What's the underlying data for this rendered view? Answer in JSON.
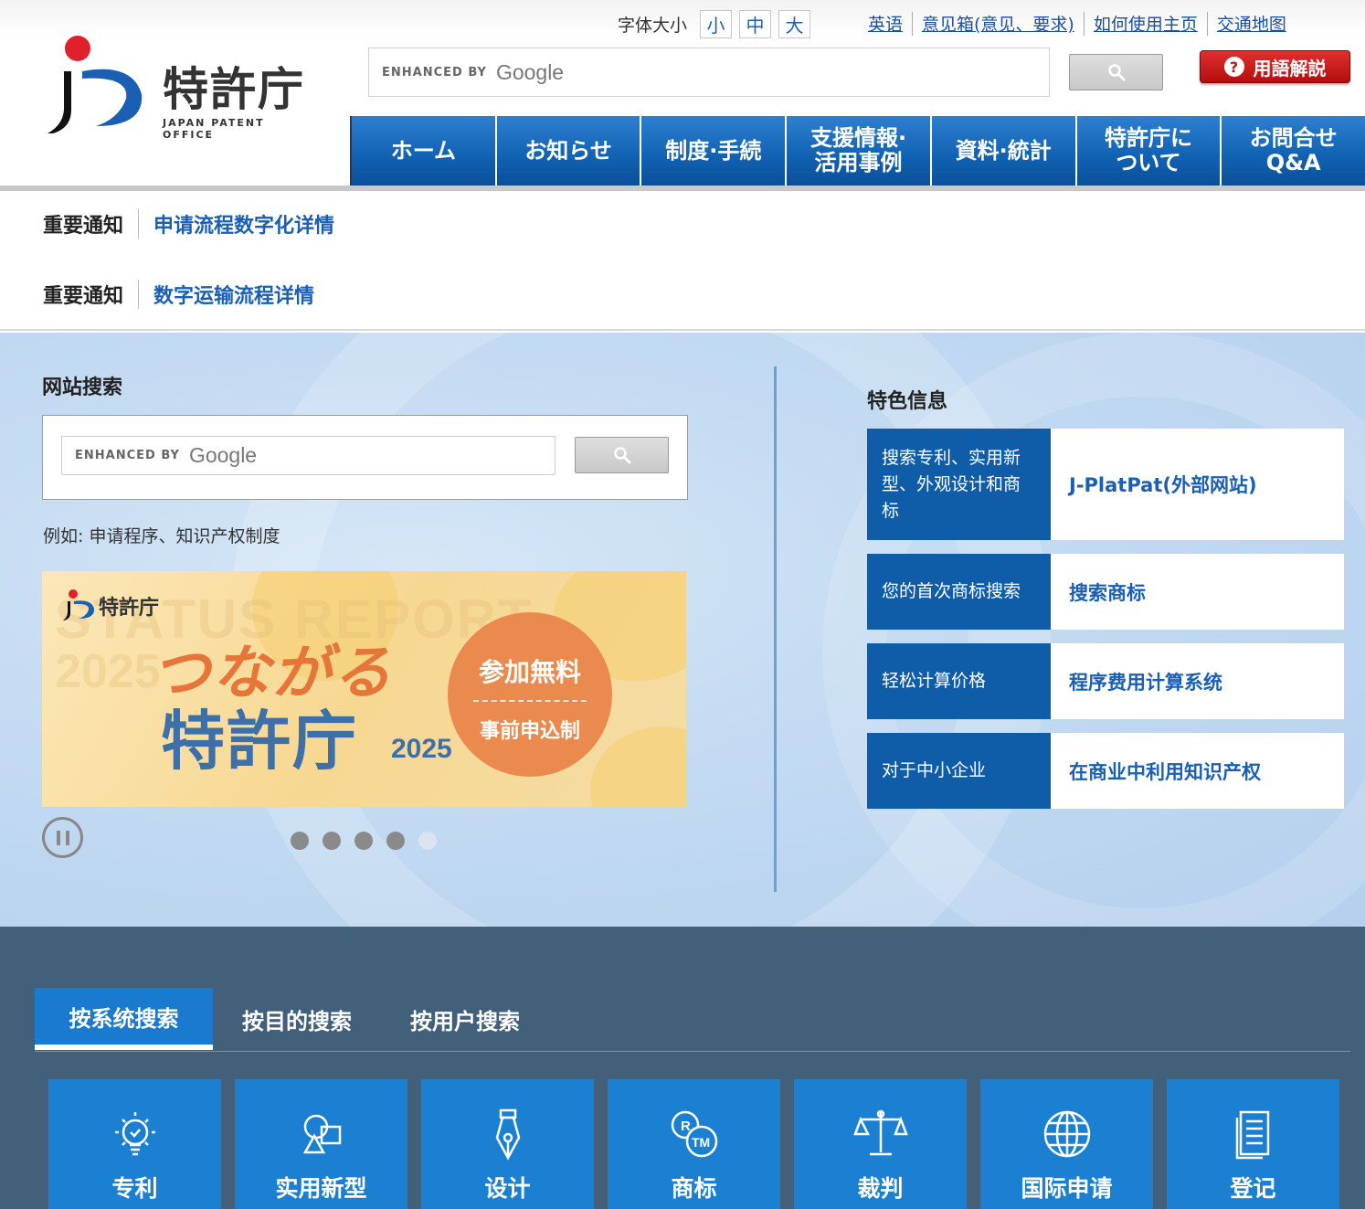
{
  "header": {
    "logo_jp": "特許庁",
    "logo_en": "JAPAN PATENT OFFICE",
    "font_size_label": "字体大小",
    "font_sizes": [
      "小",
      "中",
      "大"
    ],
    "top_links": [
      "英语",
      "意见箱(意见、要求)",
      "如何使用主页",
      "交通地图"
    ],
    "search_enhanced": "ENHANCED BY",
    "search_brand": "Google",
    "glossary_label": "用語解説",
    "nav": [
      "ホーム",
      "お知らせ",
      "制度·手続",
      "支援情報·\n活用事例",
      "資料·統計",
      "特許庁に\nついて",
      "お問合せ\nQ&A"
    ]
  },
  "notices": [
    {
      "tag": "重要通知",
      "link": "申请流程数字化详情"
    },
    {
      "tag": "重要通知",
      "link": "数字运输流程详情"
    }
  ],
  "site_search": {
    "title": "网站搜索",
    "enhanced": "ENHANCED BY",
    "brand": "Google",
    "example": "例如: 申请程序、知识产权制度"
  },
  "banner": {
    "bg_text": "STATUS REPORT",
    "bg_year": "2025",
    "brand": "特許庁",
    "line1": "つながる",
    "line2": "特許庁",
    "year": "2025",
    "badge_top": "参加無料",
    "badge_bottom": "事前申込制"
  },
  "carousel": {
    "total": 5,
    "current": 5
  },
  "featured": {
    "title": "特色信息",
    "items": [
      {
        "desc": "搜索专利、实用新型、外观设计和商标",
        "link": "J-PlatPat(外部网站)"
      },
      {
        "desc": "您的首次商标搜索",
        "link": "搜索商标"
      },
      {
        "desc": "轻松计算价格",
        "link": "程序费用计算系统"
      },
      {
        "desc": "对于中小企业",
        "link": "在商业中利用知识产权"
      }
    ]
  },
  "bottom": {
    "tabs": [
      "按系统搜索",
      "按目的搜索",
      "按用户搜索"
    ],
    "tiles": [
      {
        "label": "专利",
        "icon": "lightbulb-icon"
      },
      {
        "label": "实用新型",
        "icon": "shapes-icon"
      },
      {
        "label": "设计",
        "icon": "pen-nib-icon"
      },
      {
        "label": "商标",
        "icon": "trademark-icon"
      },
      {
        "label": "裁判",
        "icon": "scales-icon"
      },
      {
        "label": "国际申请",
        "icon": "globe-icon"
      },
      {
        "label": "登记",
        "icon": "document-icon"
      }
    ]
  },
  "colors": {
    "nav_blue": "#1161b2",
    "link_blue": "#1a5fb4",
    "feature_blue": "#0f5ca8",
    "bottom_bg": "#43607a",
    "tile_blue": "#1b7fd2",
    "glossary_red": "#c41414",
    "banner_orange": "#ea8a4e"
  }
}
